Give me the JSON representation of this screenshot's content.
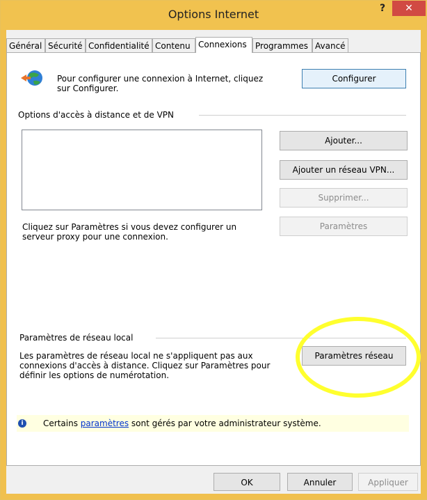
{
  "window": {
    "title": "Options Internet",
    "help_label": "?",
    "close_label": "✕"
  },
  "tabs": [
    {
      "label": "Général"
    },
    {
      "label": "Sécurité"
    },
    {
      "label": "Confidentialité"
    },
    {
      "label": "Contenu"
    },
    {
      "label": "Connexions"
    },
    {
      "label": "Programmes"
    },
    {
      "label": "Avancé"
    }
  ],
  "setup": {
    "text": "Pour configurer une connexion à Internet, cliquez sur Configurer.",
    "button": "Configurer"
  },
  "dialup": {
    "section_label": "Options d'accès à distance et de VPN",
    "add_button": "Ajouter...",
    "add_vpn_button": "Ajouter un réseau VPN...",
    "remove_button": "Supprimer...",
    "proxy_text": "Cliquez sur Paramètres si vous devez configurer un serveur proxy pour une connexion.",
    "settings_button": "Paramètres"
  },
  "lan": {
    "section_label": "Paramètres de réseau local",
    "text": "Les paramètres de réseau local ne s'appliquent pas aux connexions d'accès à distance. Cliquez sur Paramètres pour définir les options de numérotation.",
    "button": "Paramètres réseau"
  },
  "info": {
    "before": "Certains ",
    "link": "paramètres",
    "after": " sont gérés par votre administrateur système."
  },
  "footer": {
    "ok": "OK",
    "cancel": "Annuler",
    "apply": "Appliquer"
  },
  "colors": {
    "titlebar": "#f1c24f",
    "close": "#d14a43",
    "highlight": "#ffff2e",
    "infobar": "#ffffe1"
  },
  "icons": {
    "setup": "globe-connect-icon",
    "info": "info-icon"
  }
}
